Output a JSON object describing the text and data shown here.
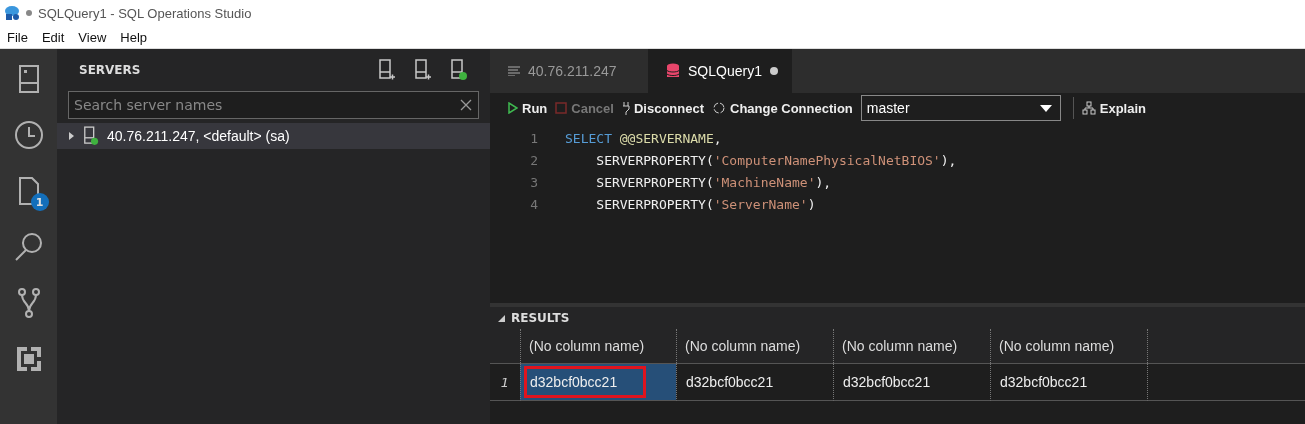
{
  "window": {
    "title": "SQLQuery1 - SQL Operations Studio",
    "dirty": true
  },
  "menu": [
    "File",
    "Edit",
    "View",
    "Help"
  ],
  "activity_bar": [
    {
      "kind": "servers",
      "selected": false
    },
    {
      "kind": "history",
      "selected": false
    },
    {
      "kind": "files",
      "selected": false,
      "badge": "1"
    },
    {
      "kind": "search",
      "selected": false
    },
    {
      "kind": "git",
      "selected": false
    },
    {
      "kind": "extensions",
      "selected": false
    }
  ],
  "sidebar": {
    "title": "SERVERS",
    "search": {
      "placeholder": "Search server names"
    },
    "servers": [
      {
        "label": "40.76.211.247, <default> (sa)",
        "expanded": false,
        "connected": true
      }
    ]
  },
  "tabs": [
    {
      "label": "40.76.211.247",
      "kind": "text",
      "selected": false,
      "dirty": false
    },
    {
      "label": "SQLQuery1",
      "kind": "database",
      "selected": true,
      "dirty": true
    }
  ],
  "toolbar": {
    "run": "Run",
    "cancel": {
      "label": "Cancel",
      "disabled": true
    },
    "disconnect": "Disconnect",
    "change_connection": "Change Connection",
    "database": "master",
    "explain": "Explain"
  },
  "code": [
    {
      "number": "1",
      "tokens": [
        {
          "kind": "keyword",
          "text": "SELECT "
        },
        {
          "kind": "variable",
          "text": "@@SERVERNAME"
        },
        {
          "kind": "plain",
          "text": ","
        }
      ]
    },
    {
      "number": "2",
      "tokens": [
        {
          "kind": "plain",
          "text": "    SERVERPROPERTY("
        },
        {
          "kind": "string",
          "text": "'ComputerNamePhysicalNetBIOS'"
        },
        {
          "kind": "plain",
          "text": "),"
        }
      ]
    },
    {
      "number": "3",
      "tokens": [
        {
          "kind": "plain",
          "text": "    SERVERPROPERTY("
        },
        {
          "kind": "string",
          "text": "'MachineName'"
        },
        {
          "kind": "plain",
          "text": "),"
        }
      ]
    },
    {
      "number": "4",
      "tokens": [
        {
          "kind": "plain",
          "text": "    SERVERPROPERTY("
        },
        {
          "kind": "string",
          "text": "'ServerName'"
        },
        {
          "kind": "plain",
          "text": ")"
        }
      ]
    }
  ],
  "results": {
    "title": "RESULTS",
    "expanded": true,
    "columns": [
      "(No column name)",
      "(No column name)",
      "(No column name)",
      "(No column name)"
    ],
    "rows": [
      {
        "number": "1",
        "cells": [
          {
            "text": "d32bcf0bcc21",
            "selected": true,
            "highlighted": true
          },
          {
            "text": "d32bcf0bcc21",
            "selected": false,
            "highlighted": false
          },
          {
            "text": "d32bcf0bcc21",
            "selected": false,
            "highlighted": false
          },
          {
            "text": "d32bcf0bcc21",
            "selected": false,
            "highlighted": false
          }
        ]
      }
    ]
  }
}
